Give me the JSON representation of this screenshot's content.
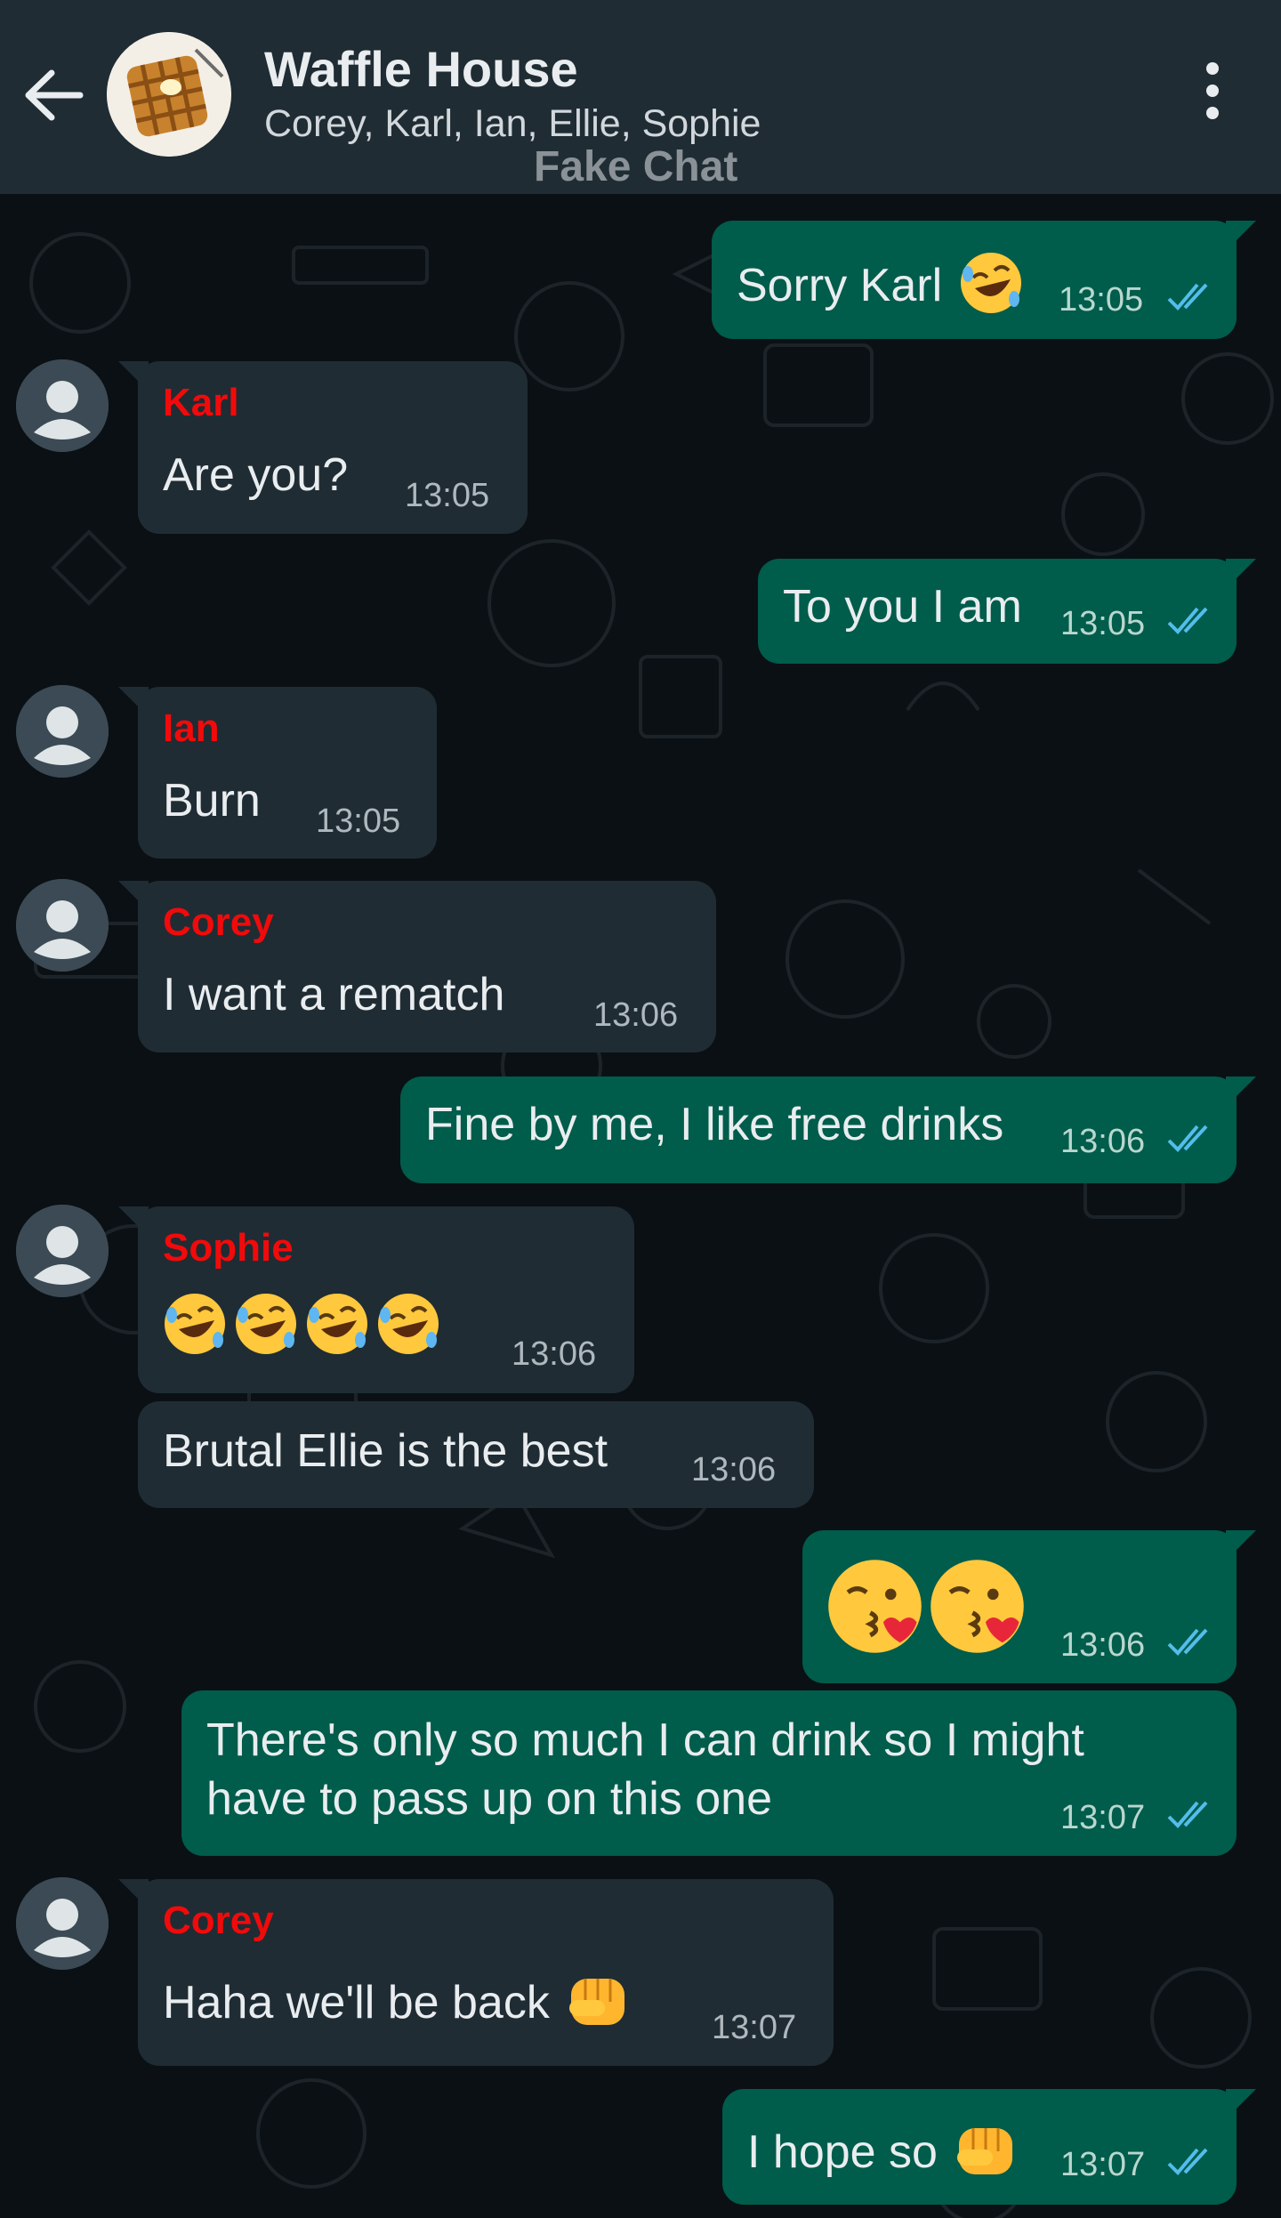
{
  "header": {
    "back_icon": "arrow-left-icon",
    "group_name": "Waffle House",
    "participants": "Corey, Karl, Ian, Ellie, Sophie",
    "watermark": "Fake Chat",
    "menu_icon": "more-vertical-icon"
  },
  "colors": {
    "header_bg": "#1f2c34",
    "chat_bg": "#0b1014",
    "outgoing_bubble": "#005c4b",
    "incoming_bubble": "#1f2c34",
    "sender_name": "#f20a0a",
    "read_ticks": "#53bdeb"
  },
  "messages": [
    {
      "dir": "out",
      "text": "Sorry Karl",
      "emoji": [
        "rofl"
      ],
      "time": "13:05"
    },
    {
      "dir": "in",
      "sender": "Karl",
      "text": "Are you?",
      "time": "13:05"
    },
    {
      "dir": "out",
      "text": "To you I am",
      "time": "13:05"
    },
    {
      "dir": "in",
      "sender": "Ian",
      "text": "Burn",
      "time": "13:05"
    },
    {
      "dir": "in",
      "sender": "Corey",
      "text": "I want a rematch",
      "time": "13:06"
    },
    {
      "dir": "out",
      "text": "Fine by me, I like free drinks",
      "time": "13:06"
    },
    {
      "dir": "in",
      "sender": "Sophie",
      "text": "",
      "emoji": [
        "rofl",
        "rofl",
        "rofl",
        "rofl"
      ],
      "time": "13:06"
    },
    {
      "dir": "in",
      "text": "Brutal Ellie is the best",
      "time": "13:06"
    },
    {
      "dir": "out",
      "text": "",
      "emoji": [
        "kiss",
        "kiss"
      ],
      "time": "13:06"
    },
    {
      "dir": "out",
      "text": "There's only so much I can drink so I might",
      "text2": "have to pass up on this one",
      "time": "13:07"
    },
    {
      "dir": "in",
      "sender": "Corey",
      "text": "Haha we'll be back",
      "emoji": [
        "fist"
      ],
      "time": "13:07"
    },
    {
      "dir": "out",
      "text": "I hope so",
      "emoji": [
        "fist"
      ],
      "time": "13:07"
    }
  ]
}
